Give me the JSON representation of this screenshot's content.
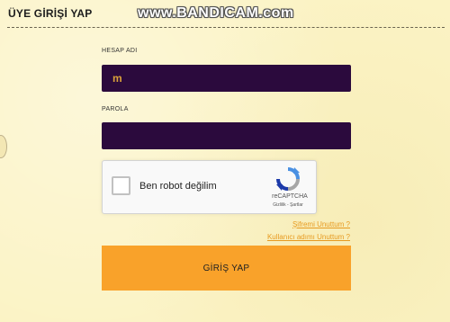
{
  "header": {
    "title": "ÜYE GİRİŞİ YAP",
    "watermark": "www.BANDICAM.com"
  },
  "form": {
    "username_label": "HESAP ADI",
    "username_value": "m",
    "password_label": "PAROLA",
    "password_value": "",
    "captcha": {
      "checkbox_label": "Ben robot değilim",
      "brand": "reCAPTCHA",
      "links": "Gizlilik - Şartlar"
    },
    "forgot_password": "Şifremi Unuttum ?",
    "forgot_username": "Kullanıcı adımı Unuttum ?",
    "submit_label": "GİRİŞ YAP"
  },
  "colors": {
    "background": "#fbf3c4",
    "field_bg": "#2b0a3d",
    "accent": "#f9a22a",
    "link": "#e79a1f"
  }
}
